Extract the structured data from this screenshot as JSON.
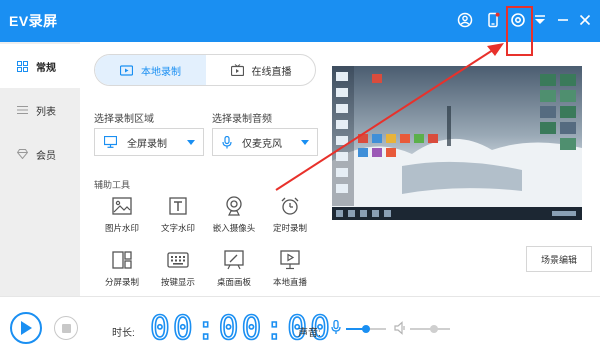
{
  "app": {
    "title": "EV录屏"
  },
  "sidebar": {
    "items": [
      {
        "label": "常规",
        "icon": "grid-icon",
        "active": true
      },
      {
        "label": "列表",
        "icon": "list-icon",
        "active": false
      },
      {
        "label": "会员",
        "icon": "diamond-icon",
        "active": false
      }
    ]
  },
  "mode_tabs": [
    {
      "label": "本地录制",
      "icon": "record-video-icon",
      "active": true
    },
    {
      "label": "在线直播",
      "icon": "tv-icon",
      "active": false
    }
  ],
  "record_area": {
    "label": "选择录制区域",
    "value": "全屏录制",
    "icon": "monitor-icon"
  },
  "record_audio": {
    "label": "选择录制音频",
    "value": "仅麦克风",
    "icon": "microphone-icon"
  },
  "tools": {
    "label": "辅助工具",
    "items": [
      {
        "label": "图片水印",
        "icon": "image-icon"
      },
      {
        "label": "文字水印",
        "icon": "text-icon"
      },
      {
        "label": "嵌入摄像头",
        "icon": "webcam-icon"
      },
      {
        "label": "定时录制",
        "icon": "alarm-clock-icon"
      },
      {
        "label": "分屏录制",
        "icon": "split-screen-icon"
      },
      {
        "label": "按键显示",
        "icon": "keyboard-icon"
      },
      {
        "label": "桌面画板",
        "icon": "drawing-board-icon"
      },
      {
        "label": "本地直播",
        "icon": "live-monitor-icon"
      }
    ]
  },
  "scene_button": "场景编辑",
  "bottom": {
    "duration_label": "时长:",
    "timer": "00:00:00",
    "volume_label": "声音:",
    "mic_level": 0.5,
    "speaker_level": 0.6
  },
  "colors": {
    "accent": "#1a8ff2",
    "annotation": "#e8312b"
  }
}
